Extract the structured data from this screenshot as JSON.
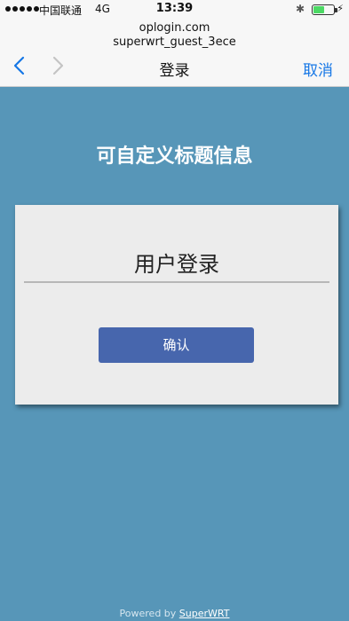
{
  "status_bar": {
    "carrier": "中国联通",
    "network": "4G",
    "time": "13:39",
    "battery_level_percent": 55
  },
  "portal_header": {
    "host": "oplogin.com",
    "ssid": "superwrt_guest_3ece",
    "title": "登录",
    "cancel_label": "取消"
  },
  "page": {
    "heading": "可自定义标题信息",
    "card_title": "用户登录",
    "confirm_label": "确认"
  },
  "footer": {
    "prefix": "Powered by",
    "brand": "SuperWRT"
  },
  "colors": {
    "background": "#5796b8",
    "accent": "#1677e6",
    "button": "#4766ad"
  }
}
